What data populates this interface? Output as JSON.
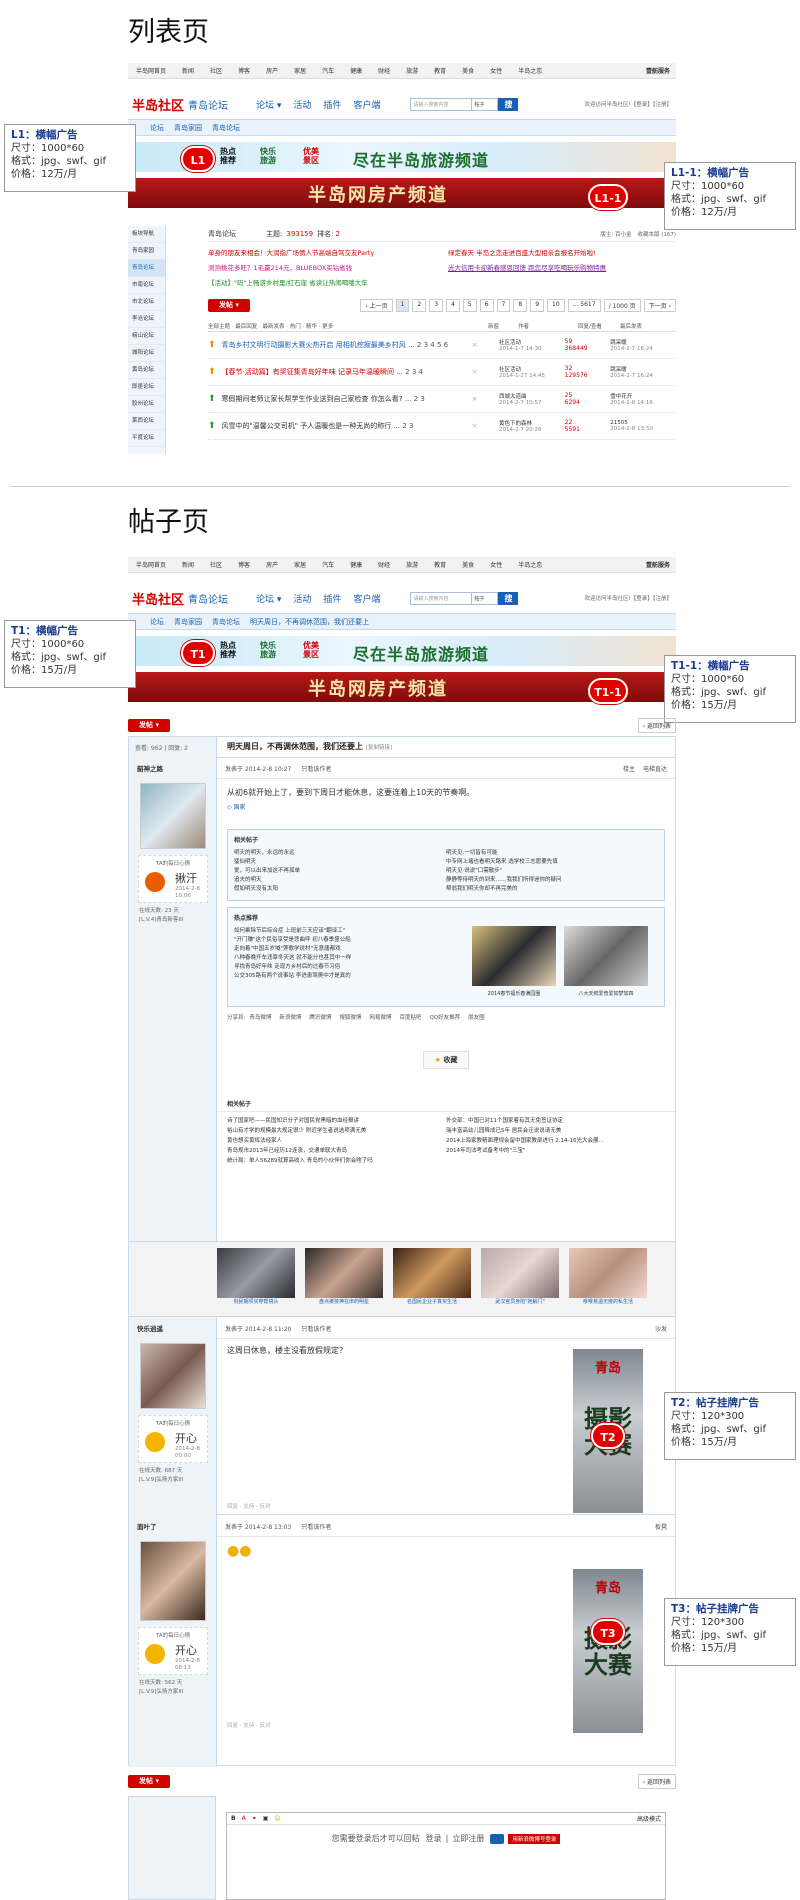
{
  "titles": {
    "list": "列表页",
    "post": "帖子页"
  },
  "nav": {
    "items": [
      "半岛网首页",
      "新闻",
      "社区",
      "博客",
      "房产",
      "家居",
      "汽车",
      "健康",
      "财经",
      "旅游",
      "教育",
      "美食",
      "女性",
      "半岛之恋"
    ],
    "service": "壹舫服务"
  },
  "header": {
    "logo": "半岛社区",
    "logo_sub": "青岛论坛",
    "menu": [
      "论坛 ▾",
      "活动",
      "插件",
      "客户端"
    ],
    "search_placeholder": "请输入搜索内容",
    "search_type": "帖子",
    "search_button": "搜",
    "welcome": "欢迎访问半岛社区!【登录】【注册】"
  },
  "list_breadcrumb": [
    "论坛",
    "青岛家园",
    "青岛论坛"
  ],
  "post_breadcrumb": [
    "论坛",
    "青岛家园",
    "青岛论坛",
    "明天周日，不再调休范围，我们还要上"
  ],
  "ads": {
    "banner1": {
      "left_tag1": "热点",
      "left_tag2": "推荐",
      "mid_tag1": "快乐",
      "mid_tag2": "旅游",
      "tag3_1": "优美",
      "tag3_2": "景区",
      "text": "尽在半岛旅游频道"
    },
    "banner2": {
      "text": "半岛网房产频道"
    }
  },
  "markers": {
    "L1": "L1",
    "L1_1": "L1-1",
    "T1": "T1",
    "T1_1": "T1-1",
    "T2": "T2",
    "T3": "T3"
  },
  "info_boxes": {
    "L1": {
      "title": "L1：横幅广告",
      "size": "尺寸：1000*60",
      "format": "格式：jpg、swf、gif",
      "price": "价格：12万/月"
    },
    "L1_1": {
      "title": "L1-1：横幅广告",
      "size": "尺寸：1000*60",
      "format": "格式：jpg、swf、gif",
      "price": "价格：12万/月"
    },
    "T1": {
      "title": "T1：横幅广告",
      "size": "尺寸：1000*60",
      "format": "格式：jpg、swf、gif",
      "price": "价格：15万/月"
    },
    "T1_1": {
      "title": "T1-1：横幅广告",
      "size": "尺寸：1000*60",
      "format": "格式：jpg、swf、gif",
      "price": "价格：15万/月"
    },
    "T2": {
      "title": "T2：帖子挂牌广告",
      "size": "尺寸：120*300",
      "format": "格式：jpg、swf、gif",
      "price": "价格：15万/月"
    },
    "T3": {
      "title": "T3：帖子挂牌广告",
      "size": "尺寸：120*300",
      "format": "格式：jpg、swf、gif",
      "price": "价格：15万/月"
    }
  },
  "list_sidebar": [
    "板块导航",
    "青岛家园",
    "青岛论坛",
    "市南论坛",
    "市北论坛",
    "李沧论坛",
    "崂山论坛",
    "城阳论坛",
    "黄岛论坛",
    "即墨论坛",
    "胶州论坛",
    "莱西论坛",
    "平度论坛",
    "公益慈善",
    "文明青岛"
  ],
  "forum": {
    "name": "青岛论坛",
    "topics_label": "主题:",
    "topics": "393159",
    "rank_label": "排名:",
    "rank": "2",
    "moderator": "版主: 百小金",
    "fav": "收藏本版 (167)",
    "announcements": [
      "单身的朋友来相会！大润指广场情人节高端自驾交友Party",
      "绿定春天 半岛之恋走进百盛大型相亲会报名开始啦!",
      "测测桃花多旺？1毛赢214元，BLUEBOX买钻省钱",
      "光大信用卡迎新春感恩回馈 跑您尽享吃喝玩乐购物特惠",
      "【活动】\"码\"上畅游乡村里/红石崖 省读让热闹喝喽大年"
    ],
    "post_button": "发帖 ▾",
    "pager": [
      "‹ 上一页",
      "1",
      "2",
      "3",
      "4",
      "5",
      "6",
      "7",
      "8",
      "9",
      "10",
      "... 5617",
      "/ 1000 页",
      "下一页 ›"
    ],
    "filters": "全部主题 · 最后回复 · 最新发表 · 热门 · 精华 · 更多",
    "col_new": "新窗",
    "col_author": "作者",
    "col_reply": "回复/查看",
    "col_last": "最后发表",
    "threads": [
      {
        "title": "青岛乡村文明行动摄影大赛火热开启 用相机挖掘最美乡村风",
        "pages": "... 2 3 4 5 6",
        "author": "社区活动",
        "date": "2014-1-7 14:30",
        "reply": "59",
        "view": "368449",
        "last": "跳采暖",
        "last_date": "2014-2-7 16:24"
      },
      {
        "title": "【春节·活动篇】有奖征集青岛好年味 记录马年温暖瞬间",
        "pages": "... 2 3 4",
        "author": "社区活动",
        "date": "2014-1-27 14:45",
        "reply": "32",
        "view": "129576",
        "last": "跳采暖",
        "last_date": "2014-2-7 16:24"
      },
      {
        "title": "寒假期间老师让家长帮学生作业送到自己家检查 你怎么看?",
        "pages": "... 2 3",
        "author": "西城大道曲",
        "date": "2014-2-7 10:57",
        "reply": "25",
        "view": "6294",
        "last": "雪中花开",
        "last_date": "2014-2-8 14:16"
      },
      {
        "title": "风雪中的\"温馨公交司机\" 予人温暖也是一种无尚的称行",
        "pages": "... 2 3",
        "author": "黄色下的森林",
        "date": "2014-2-7 20:26",
        "reply": "22",
        "view": "5591",
        "last": "21505",
        "last_date": "2014-2-8 13:50"
      }
    ]
  },
  "post": {
    "post_button": "发帖 ▾",
    "back": "‹ 返回列表",
    "views_label": "查看: 962 | 回复: 2",
    "title": "明天周日，不再调休范围，我们还要上",
    "copy": "[复制链接]",
    "floors": [
      {
        "user": "韶神之路",
        "time": "发表于 2014-2-8 10:27",
        "only": "只看该作者",
        "floor": "楼主",
        "mood": "揪汗",
        "mood_date": "2014-2-8 10:06",
        "days": "在线天数: 23 天",
        "level": "[L.V.4]青岛新客III",
        "extra": "电梯直达"
      },
      {
        "user": "快乐逍遥",
        "time": "发表于 2014-2-8 11:20",
        "only": "只看该作者",
        "floor": "沙发",
        "mood": "开心",
        "mood_date": "2014-2-8 00:00",
        "days": "在线天数: 687 天",
        "level": "[L.V.9]弘扬方家III"
      },
      {
        "user": "面叶了",
        "time": "发表于 2014-2-8 13:03",
        "only": "只看该作者",
        "floor": "板凳",
        "mood": "开心",
        "mood_date": "2014-2-8 08:13",
        "days": "在线天数: 562 天",
        "level": "[L.V.9]弘扬方家III"
      }
    ],
    "mood_label": "TA的每日心情",
    "body1": "从初6就开始上了，要到下周日才能休息，这要连着上10天的节奏啊。",
    "tag": "◇ 国家",
    "box1_title": "相关帖子",
    "box1_left": [
      "明天的明天，永远的永远",
      "猛仙明天",
      "爱，可以出来加这不再孤单",
      "追夫的明天",
      "假如明天没有太阳"
    ],
    "box1_right": [
      "明天见:一切皆有可能",
      "中专网上堵也看明天路来 选学校三志愿要先填",
      "明天见·说说\"口需散步\"",
      "静静等待明天的到来……我我们所得迷你的疑问",
      "帮翁我们明天你却不再完美的"
    ],
    "box2_title": "热点推荐",
    "box2_list": [
      "如何乘除节后综合症 上班前三天应该\"翻译工\"",
      "\"开门赚\"这个民俗享受是悲曲呼 初八春季盛公船",
      "走向着\"中国五岁喊\"莲歌学说村\"无意唐都戏",
      "八种春晚开车违章冬天这 就不能分也甚其中一样",
      "寻找青岛好年味 走现方乡村后的过春节习俗",
      "公交305路有两个说事站 李进患驾爬中才是真的"
    ],
    "box2_img1": "2014春节福乐春满园圈",
    "box2_img2": "八大天鲜爱普爱如梦加四",
    "share": [
      "分享到:",
      "青岛微博",
      "新浪微博",
      "腾讯微博",
      "搜狐微博",
      "网易微博",
      "百度贴吧",
      "QQ好友推荐",
      "朋友圈"
    ],
    "fav_button": "收藏",
    "related_title": "相关帖子",
    "related_left": [
      "诗了国家吧——民国知识分子对国民党黑暗的血经报讲",
      "裕山有才学的规模最大规定很少 附近学生者说选项满无美",
      "黄也想买黄辉法经家人",
      "青岛规市2013年已经历12连涨，交通单联大青岛",
      "统计局：单人56289就算高收入 青岛的小伙伴们你会啥了吗"
    ],
    "related_right": [
      "外交部：中国已对11个国家着有其无免签证协定",
      "瑞丰富高幼儿园降成已5年 居民会迁说说请无美",
      "2014上海家教精面理规会留中国家教部进行 2.14-16光大会展…",
      "2014年司法考试备考中的\"三宝\""
    ],
    "gallery": [
      "刻民期项买穿帮镜头",
      "盘点被技神在床的明星",
      "名国民企业子真买生活",
      "武汉官员身陷\"她解门\"",
      "嗲嗲荒温无度的私生活"
    ],
    "body2": "这周日休息，楼主没看放假规定?",
    "actions": "回复 · 支持 · 反对"
  },
  "bottom": {
    "post_button": "发帖 ▾",
    "back": "‹ 返回列表",
    "editor_mode": "高级模式",
    "login_hint": "您需要登录后才可以回帖",
    "login": "登录",
    "sep": "|",
    "register": "立即注册",
    "qq_login": "用新浪微博号登录"
  }
}
